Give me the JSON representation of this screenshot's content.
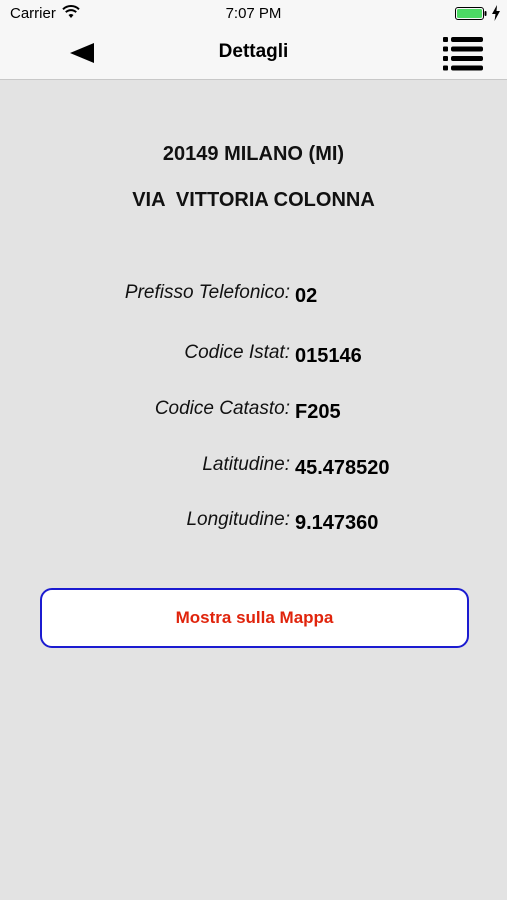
{
  "status_bar": {
    "carrier": "Carrier",
    "time": "7:07 PM",
    "battery_color": "#4cd964"
  },
  "nav": {
    "title": "Dettagli",
    "back_icon": "back-triangle-icon",
    "menu_icon": "list-menu-icon"
  },
  "address": {
    "city_line": "20149 MILANO (MI)",
    "street_line": "VIA  VITTORIA COLONNA"
  },
  "details": [
    {
      "label": "Prefisso Telefonico:",
      "value": "02"
    },
    {
      "label": "Codice Istat:",
      "value": "015146"
    },
    {
      "label": "Codice Catasto:",
      "value": "F205"
    },
    {
      "label": "Latitudine:",
      "value": "45.478520"
    },
    {
      "label": "Longitudine:",
      "value": "9.147360"
    }
  ],
  "map_button": {
    "label": "Mostra sulla Mappa",
    "text_color": "#e0240c",
    "border_color": "#1b1bd0"
  }
}
